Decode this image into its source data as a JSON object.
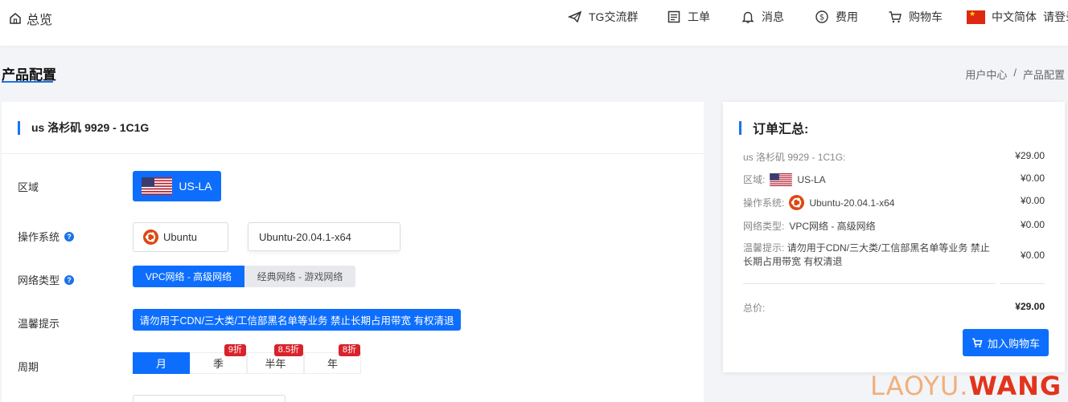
{
  "topbar": {
    "brand_label": "总览",
    "nav": [
      {
        "label": "TG交流群",
        "icon": "telegram-icon"
      },
      {
        "label": "工单",
        "icon": "ticket-icon"
      },
      {
        "label": "消息",
        "icon": "bell-icon"
      },
      {
        "label": "费用",
        "icon": "dollar-icon"
      },
      {
        "label": "购物车",
        "icon": "cart-icon"
      },
      {
        "label": "中文简体",
        "icon": "china-flag-icon"
      },
      {
        "label": "请登录"
      }
    ]
  },
  "page": {
    "title": "产品配置",
    "breadcrumb": [
      "用户中心",
      "/",
      "产品配置"
    ]
  },
  "config": {
    "product_title": "us 洛杉矶 9929 - 1C1G",
    "region_label": "区域",
    "region_value": "US-LA",
    "os_label": "操作系统",
    "os_name": "Ubuntu",
    "os_version": "Ubuntu-20.04.1-x64",
    "network_label": "网络类型",
    "network_options": [
      "VPC网络 - 高级网络",
      "经典网络 - 游戏网络"
    ],
    "tip_label": "温馨提示",
    "tip_text": "请勿用于CDN/三大类/工信部黑名单等业务 禁止长期占用带宽 有权清退",
    "period_label": "周期",
    "periods": [
      {
        "label": "月",
        "discount": ""
      },
      {
        "label": "季",
        "discount": "9折"
      },
      {
        "label": "半年",
        "discount": "8.5折"
      },
      {
        "label": "年",
        "discount": "8折"
      }
    ]
  },
  "summary": {
    "title": "订单汇总:",
    "product_line": "us 洛杉矶 9929 - 1C1G:",
    "product_price": "¥29.00",
    "region_key": "区域:",
    "region_value": "US-LA",
    "region_price": "¥0.00",
    "os_key": "操作系统:",
    "os_value": "Ubuntu-20.04.1-x64",
    "os_price": "¥0.00",
    "net_key": "网络类型:",
    "net_value": "VPC网络 - 高级网络",
    "net_price": "¥0.00",
    "tip_key": "温馨提示:",
    "tip_value_1": "请勿用于CDN/三大类/工信部黑名单等业务 禁止",
    "tip_value_2": "长期占用带宽 有权清退",
    "tip_price": "¥0.00",
    "total_key": "总价:",
    "total_price": "¥29.00",
    "cart_button": "加入购物车"
  },
  "watermark": {
    "part1": "LAOYU.",
    "part2": "WANG"
  },
  "colors": {
    "accent": "#0d6efd",
    "discount": "#d9222a"
  }
}
